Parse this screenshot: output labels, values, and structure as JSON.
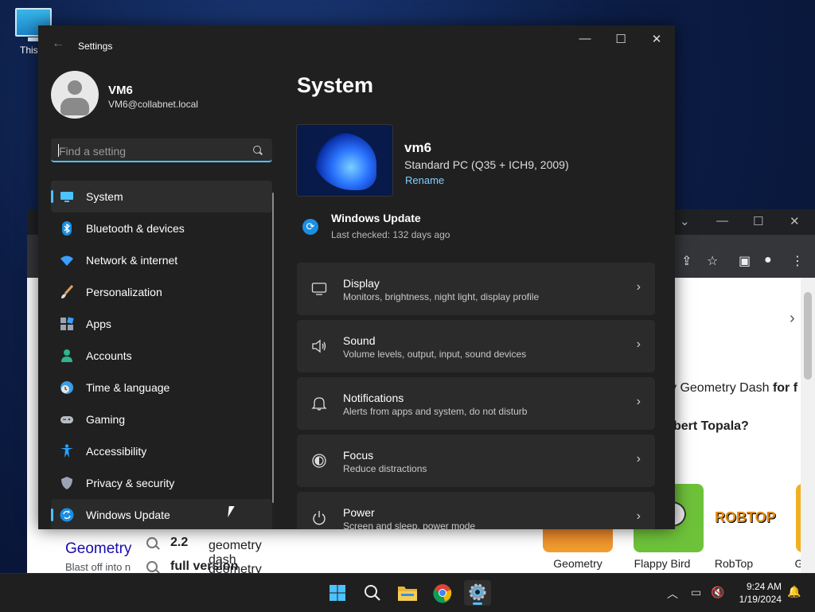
{
  "desktop": {
    "icon_label": "This P"
  },
  "browser": {
    "headline": "y Geometry Dash",
    "headline_bold": "for f",
    "question": "bert Topala?",
    "result_title": "Geometry",
    "result_snippet": "Blast off into n",
    "suggestions": [
      {
        "normal": "geometry dash ",
        "bold": "2.2"
      },
      {
        "normal": "geometry dash ",
        "bold": "full version"
      }
    ],
    "thumbs": [
      "Geometry",
      "Flappy Bird",
      "RobTop",
      "G"
    ],
    "robtop_logo": "ROBTOP"
  },
  "settings": {
    "window_title": "Settings",
    "user": {
      "name": "VM6",
      "email": "VM6@collabnet.local"
    },
    "search_placeholder": "Find a setting",
    "nav": [
      {
        "label": "System",
        "icon": "monitor-icon",
        "color": "#4cc2ff"
      },
      {
        "label": "Bluetooth & devices",
        "icon": "bluetooth-icon",
        "color": "#1a8fe3"
      },
      {
        "label": "Network & internet",
        "icon": "wifi-icon",
        "color": "#3aa0ff"
      },
      {
        "label": "Personalization",
        "icon": "brush-icon",
        "color": "#e0a060"
      },
      {
        "label": "Apps",
        "icon": "apps-icon",
        "color": "#9aa4b4"
      },
      {
        "label": "Accounts",
        "icon": "person-icon",
        "color": "#2fb48c"
      },
      {
        "label": "Time & language",
        "icon": "globe-clock-icon",
        "color": "#3a9ee8"
      },
      {
        "label": "Gaming",
        "icon": "gamepad-icon",
        "color": "#b8bcc4"
      },
      {
        "label": "Accessibility",
        "icon": "accessibility-icon",
        "color": "#2aa0ff"
      },
      {
        "label": "Privacy & security",
        "icon": "shield-icon",
        "color": "#9aa4b4"
      },
      {
        "label": "Windows Update",
        "icon": "update-icon",
        "color": "#1a8fe3"
      }
    ],
    "page_title": "System",
    "device": {
      "name": "vm6",
      "spec": "Standard PC (Q35 + ICH9, 2009)",
      "rename": "Rename"
    },
    "windows_update": {
      "title": "Windows Update",
      "subtitle": "Last checked: 132 days ago"
    },
    "cards": [
      {
        "title": "Display",
        "subtitle": "Monitors, brightness, night light, display profile",
        "icon": "display-icon"
      },
      {
        "title": "Sound",
        "subtitle": "Volume levels, output, input, sound devices",
        "icon": "speaker-icon"
      },
      {
        "title": "Notifications",
        "subtitle": "Alerts from apps and system, do not disturb",
        "icon": "bell-icon"
      },
      {
        "title": "Focus",
        "subtitle": "Reduce distractions",
        "icon": "focus-icon"
      },
      {
        "title": "Power",
        "subtitle": "Screen and sleep, power mode",
        "icon": "power-icon"
      }
    ]
  },
  "taskbar": {
    "time": "9:24 AM",
    "date": "1/19/2024",
    "apps": [
      "start-icon",
      "search-icon",
      "file-explorer-icon",
      "chrome-icon",
      "settings-icon"
    ]
  },
  "accent": "#4cc2ff"
}
